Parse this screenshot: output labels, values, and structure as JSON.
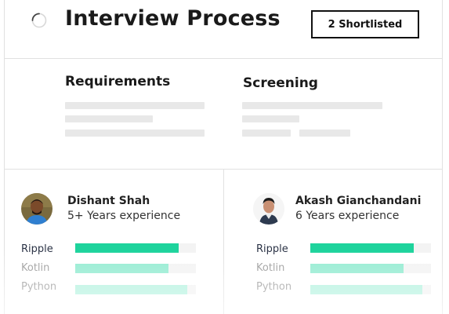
{
  "header": {
    "title": "Interview Process",
    "shortlist_button": "2 Shortlisted"
  },
  "sections": {
    "requirements": "Requirements",
    "screening": "Screening"
  },
  "candidates": [
    {
      "name": "Dishant Shah",
      "experience": "5+ Years experience",
      "skills": [
        {
          "label": "Ripple",
          "level": 0.86
        },
        {
          "label": "Kotlin",
          "level": 0.77
        },
        {
          "label": "Python",
          "level": 0.93
        }
      ]
    },
    {
      "name": "Akash Gianchandani",
      "experience": "6 Years experience",
      "skills": [
        {
          "label": "Ripple",
          "level": 0.86
        },
        {
          "label": "Kotlin",
          "level": 0.77
        },
        {
          "label": "Python",
          "level": 0.93
        }
      ]
    }
  ],
  "colors": {
    "skill_ripple": "#1ed39c",
    "skill_kotlin": "#93ebd1",
    "skill_python": "#b3f2df",
    "label_primary": "#2b3346",
    "label_muted": "#9a9a9a",
    "placeholder": "#e8e8e8"
  },
  "icons": {
    "status": "loading-spinner-icon"
  }
}
